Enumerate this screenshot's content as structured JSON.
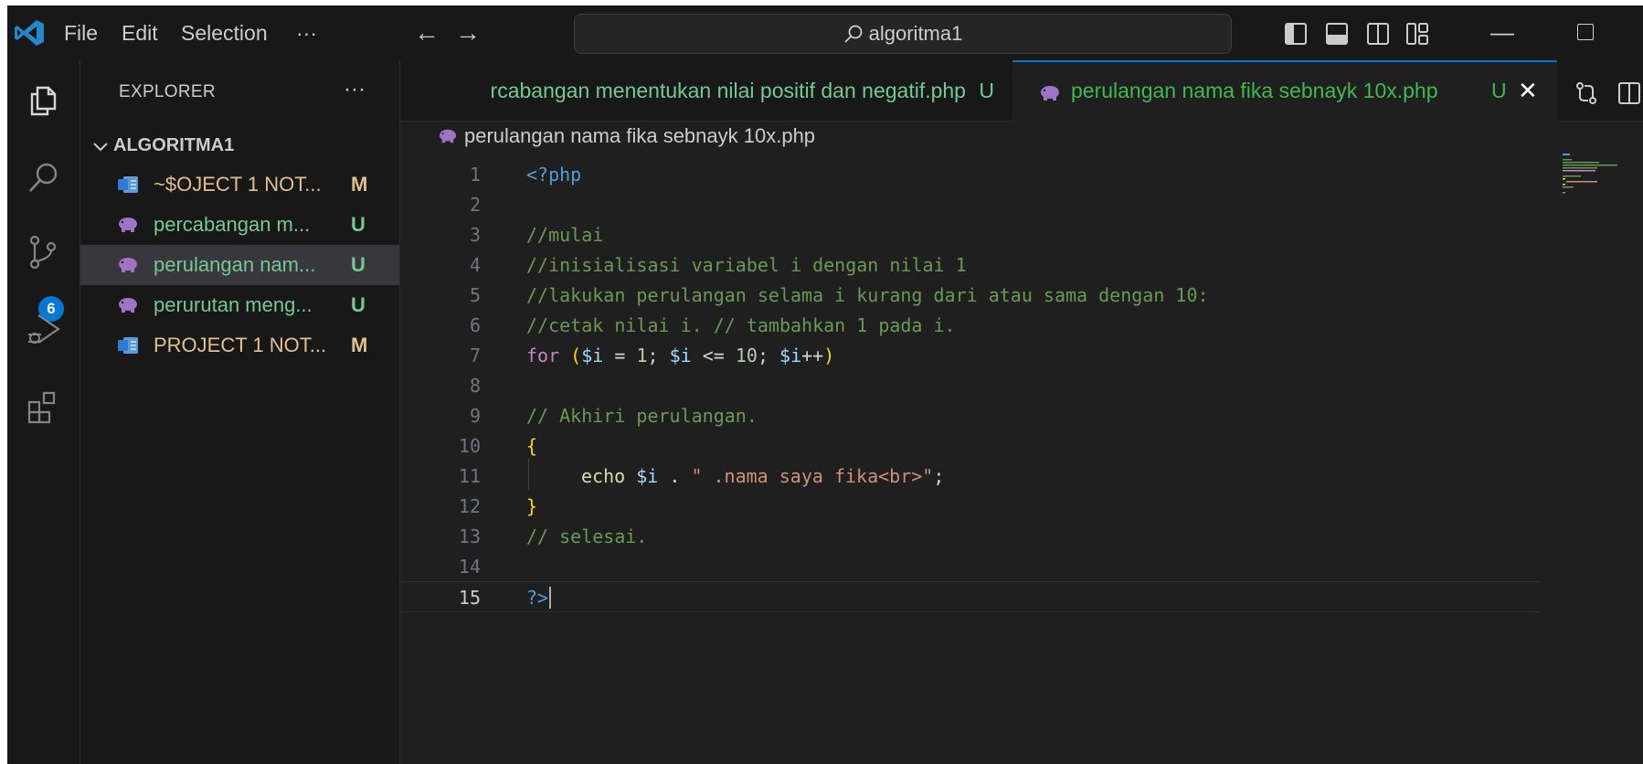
{
  "titlebar": {
    "menu": [
      "File",
      "Edit",
      "Selection",
      "···"
    ],
    "search_text": "algoritma1",
    "minimize": "—"
  },
  "activity": {
    "scm_badge": "6"
  },
  "sidebar": {
    "title": "EXPLORER",
    "more": "···",
    "folder": "ALGORITMA1",
    "files": [
      {
        "name": "~$OJECT 1 NOT...",
        "status": "M",
        "icon": "word-doc-icon",
        "color": "#e2c08d"
      },
      {
        "name": "percabangan m...",
        "status": "U",
        "icon": "php-elephant-icon",
        "color": "#73c991"
      },
      {
        "name": "perulangan nam...",
        "status": "U",
        "icon": "php-elephant-icon",
        "color": "#73c991"
      },
      {
        "name": "perurutan meng...",
        "status": "U",
        "icon": "php-elephant-icon",
        "color": "#73c991"
      },
      {
        "name": "PROJECT 1 NOT...",
        "status": "M",
        "icon": "word-doc-icon",
        "color": "#e2c08d"
      }
    ]
  },
  "tabs": [
    {
      "label": "rcabangan menentukan nilai positif dan negatif.php",
      "status": "U"
    },
    {
      "label": "perulangan nama fika sebnayk 10x.php",
      "status": "U",
      "close": "✕"
    }
  ],
  "breadcrumb": "perulangan nama fika sebnayk 10x.php",
  "editor": {
    "line_numbers": [
      "1",
      "2",
      "3",
      "4",
      "5",
      "6",
      "7",
      "8",
      "9",
      "10",
      "11",
      "12",
      "13",
      "14",
      "15"
    ],
    "code": {
      "l1": "<?php",
      "l3": "//mulai",
      "l4": "//inisialisasi variabel i dengan nilai 1",
      "l5": "//lakukan perulangan selama i kurang dari atau sama dengan 10:",
      "l6": "//cetak nilai i. // tambahkan 1 pada i.",
      "l7_kw": "for",
      "l7_open": " (",
      "l7_v1": "$i",
      "l7_eq": " = ",
      "l7_n1": "1",
      "l7_s1": "; ",
      "l7_v2": "$i",
      "l7_le": " <= ",
      "l7_n2": "10",
      "l7_s2": "; ",
      "l7_v3": "$i",
      "l7_inc": "++",
      "l7_close": ")",
      "l9": "// Akhiri perulangan.",
      "l10": "{",
      "l11_echo": "echo",
      "l11_var": "$i",
      "l11_dot": " . ",
      "l11_str": "\" .nama saya fika<br>\"",
      "l11_semi": ";",
      "l12": "}",
      "l13": "// selesai.",
      "l15": "?>"
    }
  },
  "colors": {
    "accent": "#0078d4",
    "untracked": "#73c991",
    "modified": "#e2c08d"
  }
}
